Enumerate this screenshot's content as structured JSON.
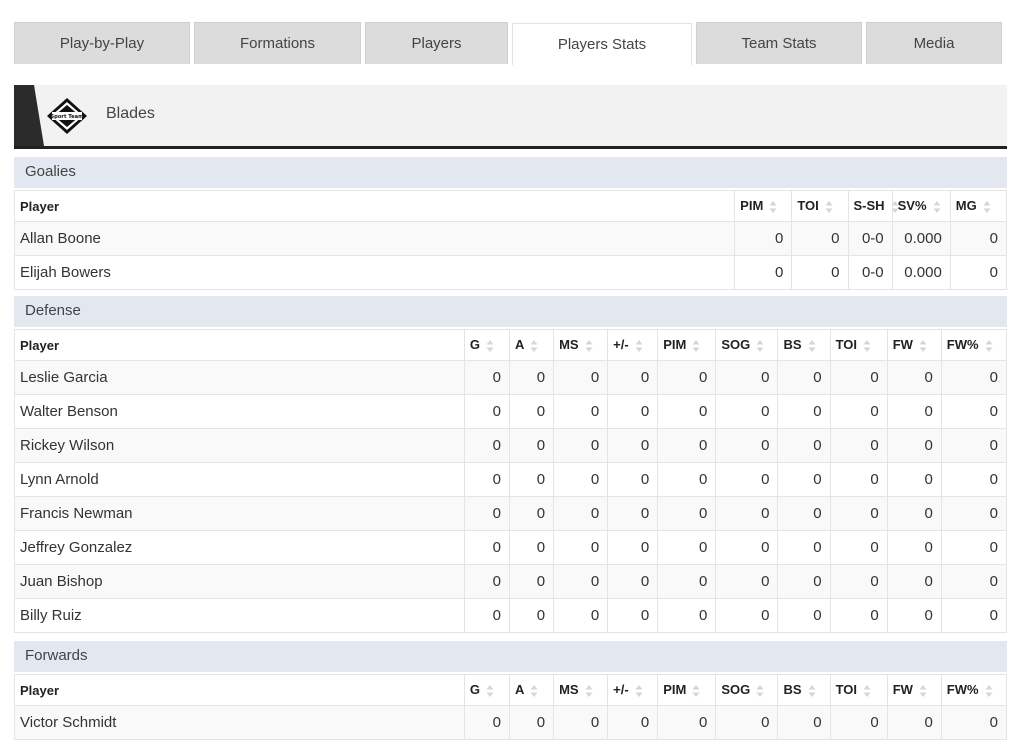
{
  "tabs": [
    {
      "label": "Play-by-Play",
      "active": false
    },
    {
      "label": "Formations",
      "active": false
    },
    {
      "label": "Players",
      "active": false
    },
    {
      "label": "Players Stats",
      "active": true
    },
    {
      "label": "Team Stats",
      "active": false
    },
    {
      "label": "Media",
      "active": false
    }
  ],
  "team": {
    "name": "Blades",
    "logo_text": "Sport Team",
    "logo_icon": "diamond-logo-icon"
  },
  "goalies": {
    "title": "Goalies",
    "columns": [
      "Player",
      "PIM",
      "TOI",
      "S-SH",
      "SV%",
      "MG"
    ],
    "rows": [
      [
        "Allan Boone",
        "0",
        "0",
        "0-0",
        "0.000",
        "0"
      ],
      [
        "Elijah Bowers",
        "0",
        "0",
        "0-0",
        "0.000",
        "0"
      ]
    ]
  },
  "defense": {
    "title": "Defense",
    "columns": [
      "Player",
      "G",
      "A",
      "MS",
      "+/-",
      "PIM",
      "SOG",
      "BS",
      "TOI",
      "FW",
      "FW%"
    ],
    "rows": [
      [
        "Leslie Garcia",
        "0",
        "0",
        "0",
        "0",
        "0",
        "0",
        "0",
        "0",
        "0",
        "0"
      ],
      [
        "Walter Benson",
        "0",
        "0",
        "0",
        "0",
        "0",
        "0",
        "0",
        "0",
        "0",
        "0"
      ],
      [
        "Rickey Wilson",
        "0",
        "0",
        "0",
        "0",
        "0",
        "0",
        "0",
        "0",
        "0",
        "0"
      ],
      [
        "Lynn Arnold",
        "0",
        "0",
        "0",
        "0",
        "0",
        "0",
        "0",
        "0",
        "0",
        "0"
      ],
      [
        "Francis Newman",
        "0",
        "0",
        "0",
        "0",
        "0",
        "0",
        "0",
        "0",
        "0",
        "0"
      ],
      [
        "Jeffrey Gonzalez",
        "0",
        "0",
        "0",
        "0",
        "0",
        "0",
        "0",
        "0",
        "0",
        "0"
      ],
      [
        "Juan Bishop",
        "0",
        "0",
        "0",
        "0",
        "0",
        "0",
        "0",
        "0",
        "0",
        "0"
      ],
      [
        "Billy Ruiz",
        "0",
        "0",
        "0",
        "0",
        "0",
        "0",
        "0",
        "0",
        "0",
        "0"
      ]
    ]
  },
  "forwards": {
    "title": "Forwards",
    "columns": [
      "Player",
      "G",
      "A",
      "MS",
      "+/-",
      "PIM",
      "SOG",
      "BS",
      "TOI",
      "FW",
      "FW%"
    ],
    "rows": [
      [
        "Victor Schmidt",
        "0",
        "0",
        "0",
        "0",
        "0",
        "0",
        "0",
        "0",
        "0",
        "0"
      ]
    ]
  },
  "colors": {
    "section_bg": "#e3e8f0",
    "tab_bg": "#dcdcdc",
    "header_border": "#222222",
    "stripe": "#2b2b2b"
  }
}
